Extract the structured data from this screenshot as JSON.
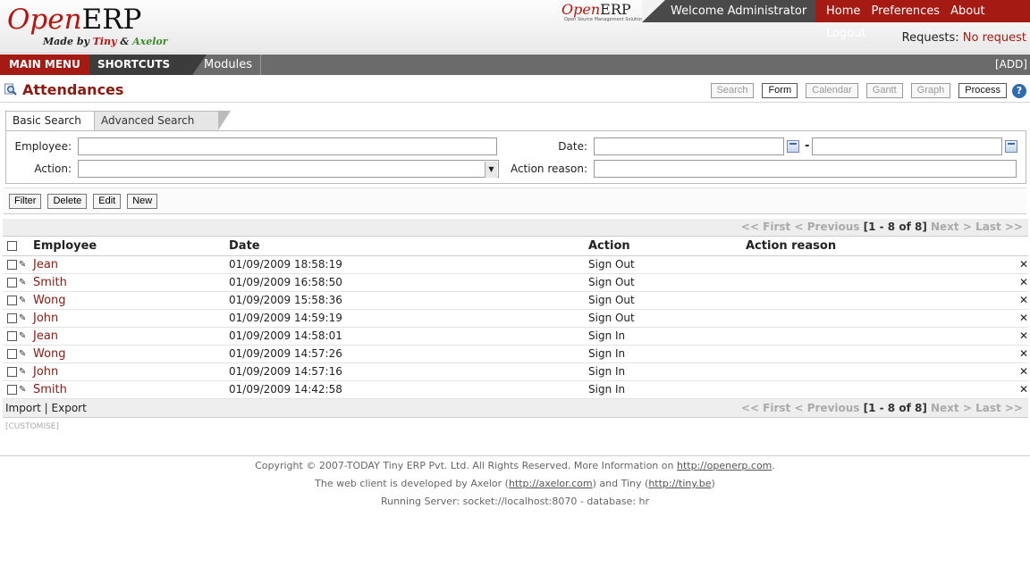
{
  "logo": {
    "open": "Open",
    "erp": "ERP",
    "made_by": "Made by",
    "tiny": "Tiny",
    "amp": "&",
    "axelor": "Axelor",
    "small_tagline": "Open Source Management Solution"
  },
  "header": {
    "welcome": "Welcome Administrator",
    "links": [
      "Home",
      "Preferences",
      "About",
      "Logout"
    ],
    "requests_label": "Requests:",
    "requests_value": "No request"
  },
  "menubar": {
    "main_menu": "MAIN MENU",
    "shortcuts": "SHORTCUTS",
    "modules": "Modules",
    "add": "[ADD]"
  },
  "page": {
    "title": "Attendances",
    "view_buttons": [
      "Search",
      "Form",
      "Calendar",
      "Gantt",
      "Graph",
      "Process"
    ],
    "help": "?"
  },
  "search": {
    "tab_basic": "Basic Search",
    "tab_advanced": "Advanced Search",
    "employee_label": "Employee:",
    "action_label": "Action:",
    "date_label": "Date:",
    "date_separator": "-",
    "action_reason_label": "Action reason:"
  },
  "actions": [
    "Filter",
    "Delete",
    "Edit",
    "New"
  ],
  "pager": {
    "first": "<< First",
    "previous": "< Previous",
    "range": "[1 - 8 of 8]",
    "next": "Next >",
    "last": "Last >>"
  },
  "grid": {
    "columns": [
      "Employee",
      "Date",
      "Action",
      "Action reason"
    ],
    "rows": [
      {
        "employee": "Jean",
        "date": "01/09/2009 18:58:19",
        "action": "Sign Out",
        "reason": ""
      },
      {
        "employee": "Smith",
        "date": "01/09/2009 16:58:50",
        "action": "Sign Out",
        "reason": ""
      },
      {
        "employee": "Wong",
        "date": "01/09/2009 15:58:36",
        "action": "Sign Out",
        "reason": ""
      },
      {
        "employee": "John",
        "date": "01/09/2009 14:59:19",
        "action": "Sign Out",
        "reason": ""
      },
      {
        "employee": "Jean",
        "date": "01/09/2009 14:58:01",
        "action": "Sign In",
        "reason": ""
      },
      {
        "employee": "Wong",
        "date": "01/09/2009 14:57:26",
        "action": "Sign In",
        "reason": ""
      },
      {
        "employee": "John",
        "date": "01/09/2009 14:57:16",
        "action": "Sign In",
        "reason": ""
      },
      {
        "employee": "Smith",
        "date": "01/09/2009 14:42:58",
        "action": "Sign In",
        "reason": ""
      }
    ],
    "delete_glyph": "✕",
    "edit_glyph": "✎"
  },
  "grid_footer": {
    "import": "Import",
    "separator": "|",
    "export": "Export"
  },
  "customise": "[CUSTOMISE]",
  "footer": {
    "line1_prefix": "Copyright © 2007-TODAY Tiny ERP Pvt. Ltd. All Rights Reserved. More Information on ",
    "line1_link": "http://openerp.com",
    "line1_suffix": ".",
    "line2_prefix": "The web client is developed by Axelor (",
    "line2_link1": "http://axelor.com",
    "line2_mid": ") and Tiny (",
    "line2_link2": "http://tiny.be",
    "line2_suffix": ")",
    "line3": "Running Server: socket://localhost:8070 - database: hr"
  },
  "colors": {
    "brand_red": "#a51b14",
    "title_red": "#8b1a10",
    "dark_gray": "#4a4a4a"
  },
  "icons": {
    "title_icon": "search-magnifier-icon",
    "calendar": "calendar-icon",
    "help": "help-icon",
    "delete": "delete-x-icon",
    "edit": "pencil-icon"
  }
}
